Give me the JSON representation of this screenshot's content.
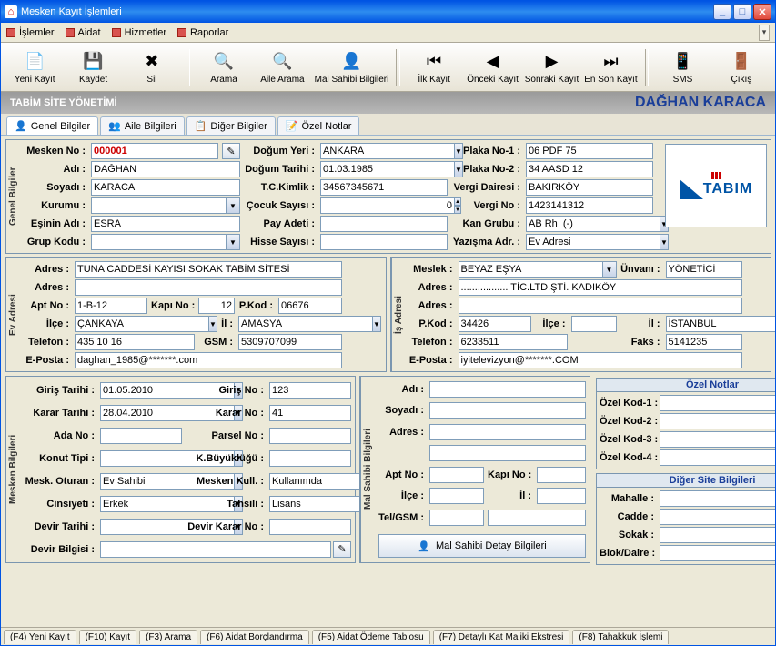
{
  "window": {
    "title": "Mesken Kayıt İşlemleri"
  },
  "menu": {
    "islemler": "İşlemler",
    "aidat": "Aidat",
    "hizmetler": "Hizmetler",
    "raporlar": "Raporlar"
  },
  "toolbar": {
    "yeni": "Yeni Kayıt",
    "kaydet": "Kaydet",
    "sil": "Sil",
    "arama": "Arama",
    "aile": "Aile Arama",
    "malsahibi": "Mal Sahibi Bilgileri",
    "ilk": "İlk Kayıt",
    "onceki": "Önceki Kayıt",
    "sonraki": "Sonraki Kayıt",
    "enson": "En Son Kayıt",
    "sms": "SMS",
    "cikis": "Çıkış"
  },
  "banner": {
    "left": "TABİM SİTE YÖNETİMİ",
    "right": "DAĞHAN KARACA"
  },
  "tabs": {
    "genel": "Genel Bilgiler",
    "aile": "Aile Bilgileri",
    "diger": "Diğer Bilgiler",
    "ozel": "Özel Notlar"
  },
  "labels": {
    "meskenno": "Mesken No :",
    "adi": "Adı :",
    "soyadi": "Soyadı :",
    "kurumu": "Kurumu :",
    "esadi": "Eşinin Adı :",
    "grupkodu": "Grup Kodu :",
    "dogumyeri": "Doğum Yeri :",
    "dogumtarihi": "Doğum Tarihi :",
    "tckimlik": "T.C.Kimlik :",
    "cocuk": "Çocuk Sayısı :",
    "payadeti": "Pay Adeti :",
    "hisse": "Hisse Sayısı :",
    "plaka1": "Plaka No-1 :",
    "plaka2": "Plaka No-2 :",
    "vergidairesi": "Vergi Dairesi :",
    "vergino": "Vergi No :",
    "kangrubu": "Kan Grubu :",
    "yazisma": "Yazışma Adr. :",
    "adres": "Adres :",
    "aptno": "Apt No :",
    "kapino": "Kapı No :",
    "pkod": "P.Kod :",
    "ilce": "İlçe :",
    "il": "İl :",
    "telefon": "Telefon :",
    "gsm": "GSM :",
    "eposta": "E-Posta :",
    "meslek": "Meslek :",
    "unvani": "Ünvanı :",
    "faks": "Faks :",
    "giristarihi": "Giriş Tarihi :",
    "karartarihi": "Karar Tarihi :",
    "adano": "Ada No :",
    "konuttipi": "Konut Tipi :",
    "meskoturan": "Mesk. Oturan :",
    "cinsiyeti": "Cinsiyeti :",
    "devirtarihi": "Devir Tarihi :",
    "devirbilgisi": "Devir Bilgisi :",
    "girisno": "Giriş No :",
    "kararno": "Karar No :",
    "parselno": "Parsel No :",
    "kbuyuk": "K.Büyüklüğü :",
    "meskenkull": "Mesken Kull. :",
    "tahsili": "Tahsili :",
    "devirkararno": "Devir Karar No :",
    "telgsm": "Tel/GSM :",
    "malsahibibtn": "Mal Sahibi Detay Bilgileri",
    "ozelnotlar": "Özel Notlar",
    "ozelkod1": "Özel Kod-1 :",
    "ozelkod2": "Özel Kod-2 :",
    "ozelkod3": "Özel Kod-3 :",
    "ozelkod4": "Özel Kod-4 :",
    "digersite": "Diğer Site Bilgileri",
    "mahalle": "Mahalle :",
    "cadde": "Cadde :",
    "sokak": "Sokak :",
    "blokdaire": "Blok/Daire :"
  },
  "sections": {
    "genel": "Genel Bilgiler",
    "ev": "Ev Adresi",
    "is": "İş Adresi",
    "mesken": "Mesken Bilgileri",
    "malsahibi": "Mal Sahibi Bilgileri"
  },
  "values": {
    "meskenno": "000001",
    "adi": "DAĞHAN",
    "soyadi": "KARACA",
    "kurumu": "",
    "esadi": "ESRA",
    "grupkodu": "",
    "dogumyeri": "ANKARA",
    "dogumtarihi": "01.03.1985",
    "tckimlik": "34567345671",
    "cocuk": "0",
    "payadeti": "",
    "hisse": "",
    "plaka1": "06 PDF 75",
    "plaka2": "34 AASD 12",
    "vergidairesi": "BAKIRKÖY",
    "vergino": "1423141312",
    "kangrubu": "AB Rh  (-)",
    "yazisma": "Ev Adresi",
    "ev_adres1": "TUNA CADDESİ KAYISI SOKAK TABİM SİTESİ",
    "ev_adres2": "",
    "ev_aptno": "1-B-12",
    "ev_kapino": "12",
    "ev_pkod": "06676",
    "ev_ilce": "ÇANKAYA",
    "ev_il": "AMASYA",
    "ev_tel": "435 10 16",
    "ev_gsm": "5309707099",
    "ev_eposta": "daghan_1985@*******.com",
    "is_meslek": "BEYAZ EŞYA",
    "is_unvani": "YÖNETİCİ",
    "is_adres1": "................. TİC.LTD.ŞTİ. KADIKÖY",
    "is_adres2": "",
    "is_pkod": "34426",
    "is_ilce": "",
    "is_il": "İSTANBUL",
    "is_tel": "6233511",
    "is_faks": "5141235",
    "is_eposta": "iyitelevizyon@*******.COM",
    "giristarihi": "01.05.2010",
    "karartarihi": "28.04.2010",
    "adano": "",
    "konuttipi": "",
    "meskoturan": "Ev Sahibi",
    "cinsiyeti": "Erkek",
    "devirtarihi": "",
    "devirbilgisi": "",
    "girisno": "123",
    "kararno": "41",
    "parselno": "",
    "kbuyuk": "",
    "meskenkull": "Kullanımda",
    "tahsili": "Lisans",
    "devirkararno": "",
    "ms_adi": "",
    "ms_soyadi": "",
    "ms_adres1": "",
    "ms_adres2": "",
    "ms_aptno": "",
    "ms_kapino": "",
    "ms_ilce": "",
    "ms_il": "",
    "ms_tel": "",
    "ms_gsm": "",
    "ozelkod1": "",
    "ozelkod2": "",
    "ozelkod3": "",
    "ozelkod4": "",
    "mahalle": "",
    "cadde": "",
    "sokak": "",
    "blok": "",
    "daire": ""
  },
  "fkeys": {
    "f4": "(F4) Yeni Kayıt",
    "f10": "(F10) Kayıt",
    "f3": "(F3) Arama",
    "f6": "(F6) Aidat Borçlandırma",
    "f5": "(F5) Aidat Ödeme Tablosu",
    "f7": "(F7) Detaylı Kat Maliki Ekstresi",
    "f8": "(F8) Tahakkuk İşlemi"
  },
  "logo": "TABIM"
}
